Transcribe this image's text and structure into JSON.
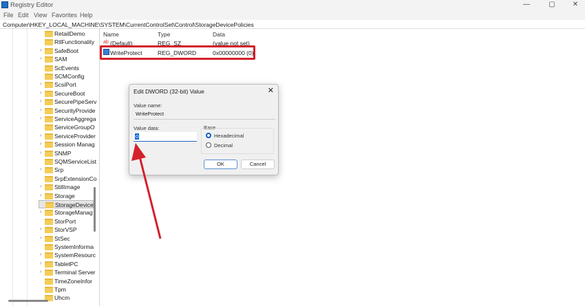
{
  "window": {
    "title": "Registry Editor",
    "minimize": "—",
    "maximize": "▢",
    "close": "✕"
  },
  "menu": [
    "File",
    "Edit",
    "View",
    "Favorites",
    "Help"
  ],
  "address": "Computer\\HKEY_LOCAL_MACHINE\\SYSTEM\\CurrentControlSet\\Control\\StorageDevicePolicies",
  "tree": [
    {
      "label": "RetailDemo",
      "exp": false
    },
    {
      "label": "RtlFunctionality",
      "exp": false
    },
    {
      "label": "SafeBoot",
      "exp": true
    },
    {
      "label": "SAM",
      "exp": true
    },
    {
      "label": "ScEvents",
      "exp": false
    },
    {
      "label": "SCMConfig",
      "exp": false
    },
    {
      "label": "ScsiPort",
      "exp": true
    },
    {
      "label": "SecureBoot",
      "exp": true
    },
    {
      "label": "SecurePipeServ",
      "exp": true
    },
    {
      "label": "SecurityProvide",
      "exp": true
    },
    {
      "label": "ServiceAggrega",
      "exp": true
    },
    {
      "label": "ServiceGroupO",
      "exp": false
    },
    {
      "label": "ServiceProvider",
      "exp": true
    },
    {
      "label": "Session Manag",
      "exp": true
    },
    {
      "label": "SNMP",
      "exp": true
    },
    {
      "label": "SQMServiceList",
      "exp": false
    },
    {
      "label": "Srp",
      "exp": true
    },
    {
      "label": "SrpExtensionCo",
      "exp": false
    },
    {
      "label": "StillImage",
      "exp": true
    },
    {
      "label": "Storage",
      "exp": true
    },
    {
      "label": "StorageDeviceI",
      "exp": false,
      "selected": true
    },
    {
      "label": "StorageManag",
      "exp": true
    },
    {
      "label": "StorPort",
      "exp": false
    },
    {
      "label": "StorVSP",
      "exp": true
    },
    {
      "label": "StSec",
      "exp": true
    },
    {
      "label": "SystemInforma",
      "exp": false
    },
    {
      "label": "SystemResourc",
      "exp": true
    },
    {
      "label": "TabletPC",
      "exp": true
    },
    {
      "label": "Terminal Server",
      "exp": true
    },
    {
      "label": "TimeZoneInfor",
      "exp": false
    },
    {
      "label": "Tpm",
      "exp": false
    },
    {
      "label": "Uhcm",
      "exp": false
    }
  ],
  "columns": {
    "name": "Name",
    "type": "Type",
    "data": "Data"
  },
  "values": [
    {
      "icon": "ab",
      "name": "(Default)",
      "type": "REG_SZ",
      "data": "(value not set)"
    },
    {
      "icon": "dword",
      "name": "WriteProtect",
      "type": "REG_DWORD",
      "data": "0x00000000 (0)"
    }
  ],
  "dialog": {
    "title": "Edit DWORD (32-bit) Value",
    "value_name_label": "Value name:",
    "value_name": "WriteProtect",
    "value_data_label": "Value data:",
    "value_data": "0",
    "base_label": "Base",
    "hex": "Hexadecimal",
    "dec": "Decimal",
    "selected_base": "Hexadecimal",
    "ok": "OK",
    "cancel": "Cancel"
  },
  "colors": {
    "highlight": "#d3202c",
    "accent": "#0a5bc4"
  }
}
